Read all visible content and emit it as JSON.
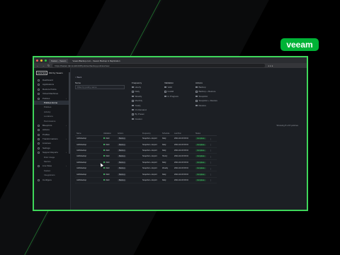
{
  "brand_logo": "veeam",
  "accent": "#3ed65a",
  "browser": {
    "tabs": [
      {
        "label": "Kasten - Veeam"
      },
      {
        "label": "VeeamBackup.com - Veeam Backup & Replication"
      }
    ],
    "url": "https://kasten.lab.local/k10/#/policies/backup-policies/view"
  },
  "app": {
    "brand_box": "KASTEN",
    "brand_name": "K10 by Veeam"
  },
  "sidebar": {
    "items": [
      {
        "label": "Dashboard",
        "level": 0,
        "active": false
      },
      {
        "label": "Applications",
        "level": 0,
        "active": false
      },
      {
        "label": "Restore Points",
        "level": 0,
        "active": false
      },
      {
        "label": "Virtual Machines",
        "level": 0,
        "active": false
      },
      {
        "label": "Policies",
        "level": 0,
        "active": false,
        "chevron": true
      },
      {
        "label": "Policies Home",
        "level": 1,
        "active": true
      },
      {
        "label": "Policies",
        "level": 1,
        "active": false
      },
      {
        "label": "Activity",
        "level": 1,
        "active": false
      },
      {
        "label": "Locations",
        "level": 1,
        "active": false
      },
      {
        "label": "Permissions",
        "level": 1,
        "active": false
      },
      {
        "label": "Blueprints",
        "level": 0,
        "active": false,
        "chevron": true
      },
      {
        "label": "Actions",
        "level": 0,
        "active": false
      },
      {
        "label": "Profiles",
        "level": 0,
        "active": false
      },
      {
        "label": "Transformations",
        "level": 0,
        "active": false,
        "chevron": true
      },
      {
        "label": "Licenses",
        "level": 0,
        "active": false
      },
      {
        "label": "Settings",
        "level": 0,
        "active": false
      },
      {
        "label": "Support Reports",
        "level": 0,
        "active": false,
        "chevron": true
      },
      {
        "label": "Disk Usage",
        "level": 1,
        "active": false
      },
      {
        "label": "Metrics",
        "level": 1,
        "active": false
      },
      {
        "label": "Live Sites",
        "level": 0,
        "active": false,
        "chevron": true
      },
      {
        "label": "Kasten",
        "level": 1,
        "active": false
      },
      {
        "label": "Integrations",
        "level": 1,
        "active": false
      },
      {
        "label": "Configure",
        "level": 0,
        "active": false
      }
    ]
  },
  "main": {
    "back_label": "< Back",
    "name_label": "Name",
    "search_placeholder": "Filter by policy name",
    "filters": [
      {
        "title": "Frequency",
        "options": [
          "Hourly",
          "Daily",
          "Weekly",
          "Monthly",
          "Yearly",
          "On Demand",
          "By Preset",
          "Custom"
        ]
      },
      {
        "title": "Validation",
        "options": [
          "Valid",
          "Invalid",
          "In Progress"
        ]
      },
      {
        "title": "Actions",
        "options": [
          "Backup",
          "Backup + Restore",
          "Snapshot",
          "Snapshot + Restore",
          "Restore"
        ]
      }
    ],
    "rows_info": "Showing 8 of 8 policies",
    "table": {
      "columns": [
        "Name",
        "Validation",
        "Actions",
        "Frequency",
        "Schedule",
        "Last Run",
        "Status",
        ""
      ],
      "rows": [
        {
          "name": "mk8sbackup",
          "validation": "Valid",
          "action": "Backup",
          "frequency": "Snapshot + Export",
          "schedule": "Daily",
          "last_run": "2024-10-03 09:04",
          "status": "Complete"
        },
        {
          "name": "mk8sbackup",
          "validation": "Valid",
          "action": "Backup",
          "frequency": "Snapshot + Export",
          "schedule": "Daily",
          "last_run": "2024-10-03 09:04",
          "status": "Complete"
        },
        {
          "name": "mk8sbackup",
          "validation": "Valid",
          "action": "Backup",
          "frequency": "Snapshot + Export",
          "schedule": "Daily",
          "last_run": "2024-10-03 09:04",
          "status": "Complete"
        },
        {
          "name": "mk8sbackup",
          "validation": "Valid",
          "action": "Backup",
          "frequency": "Snapshot + Export",
          "schedule": "Hourly",
          "last_run": "2024-10-03 09:04",
          "status": "Complete"
        },
        {
          "name": "mk8sbackup",
          "validation": "Valid",
          "action": "Backup",
          "frequency": "Snapshot + Export",
          "schedule": "Daily",
          "last_run": "2024-10-03 09:04",
          "status": "Complete"
        },
        {
          "name": "mk8sbackup",
          "validation": "Valid",
          "action": "Backup",
          "frequency": "Snapshot + Export",
          "schedule": "Weekly",
          "last_run": "2024-10-03 09:04",
          "status": "Complete"
        },
        {
          "name": "mk8sbackup",
          "validation": "Valid",
          "action": "Backup",
          "frequency": "Snapshot + Export",
          "schedule": "Daily",
          "last_run": "2024-10-03 09:04",
          "status": "Complete"
        },
        {
          "name": "mk8sbackup",
          "validation": "Valid",
          "action": "Backup",
          "frequency": "Snapshot + Export",
          "schedule": "Daily",
          "last_run": "2024-10-03 09:04",
          "status": "Complete"
        }
      ]
    }
  }
}
